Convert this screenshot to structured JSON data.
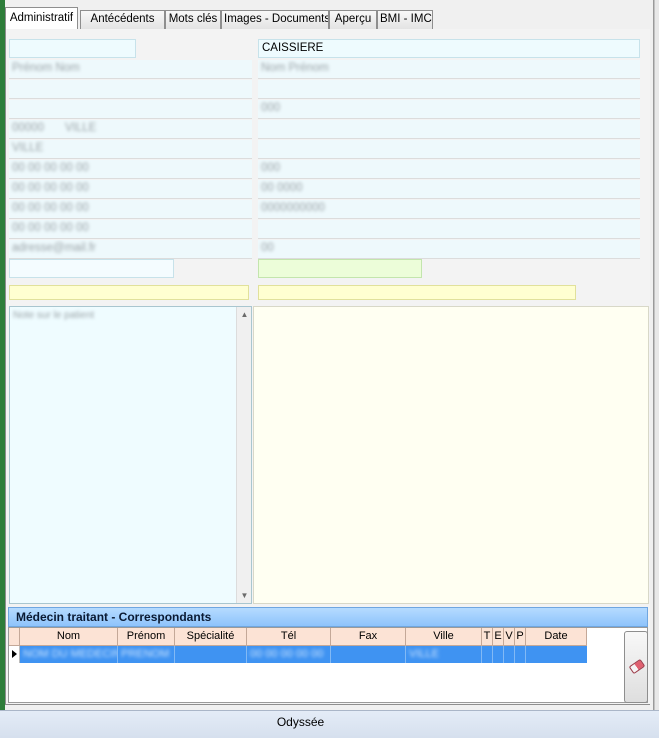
{
  "tabs": [
    {
      "label": "Administratif",
      "active": true
    },
    {
      "label": "Antécédents",
      "active": false
    },
    {
      "label": "Mots clés",
      "active": false
    },
    {
      "label": "Images - Documents",
      "active": false
    },
    {
      "label": "Aperçu",
      "active": false
    },
    {
      "label": "BMI - IMC",
      "active": false
    }
  ],
  "admin": {
    "left_fields": {
      "f1": "",
      "f2": "Prénom Nom",
      "f3": "",
      "f4": "",
      "f5a": "00000",
      "f5b": "VILLE",
      "f6": "VILLE",
      "f7": "00 00 00 00 00",
      "f8": "00 00 00 00 00",
      "f9": "00 00 00 00 00",
      "f10": "00 00 00 00 00",
      "f11": "adresse@mail.fr",
      "f12": ""
    },
    "right_fields": {
      "r1": "CAISSIERE",
      "r2": "Nom Prénom",
      "r3": "",
      "r4": "000",
      "r5": "",
      "r6": "",
      "r7": "000",
      "r8": "00 0000",
      "r9": "0000000000",
      "r10": "",
      "r11": "00",
      "r12": ""
    },
    "notes": "Note sur le patient"
  },
  "correspondants": {
    "title": "Médecin traitant - Correspondants",
    "columns": [
      "Nom",
      "Prénom",
      "Spécialité",
      "Tél",
      "Fax",
      "Ville",
      "T",
      "E",
      "V",
      "P",
      "Date"
    ],
    "rows": [
      [
        "NOM DU MEDECIN",
        "PRENOM",
        "",
        "00 00 00 00 00",
        "",
        "VILLE",
        "",
        "",
        "",
        "",
        ""
      ]
    ]
  },
  "icons": {
    "eraser": "eraser-icon",
    "scroll_up": "scroll-up-arrow",
    "scroll_down": "scroll-down-arrow",
    "row_pointer": "row-pointer-icon"
  },
  "status": {
    "text": "Odyssée"
  },
  "colors": {
    "accent_green": "#2e7d3a",
    "field_blue": "#eefbfe",
    "field_green": "#ecfdd9",
    "field_yellow": "#ffffd1",
    "header_blue": "#8ec3fb",
    "grid_header": "#fce3d5",
    "selected_row": "#3f93f2"
  }
}
